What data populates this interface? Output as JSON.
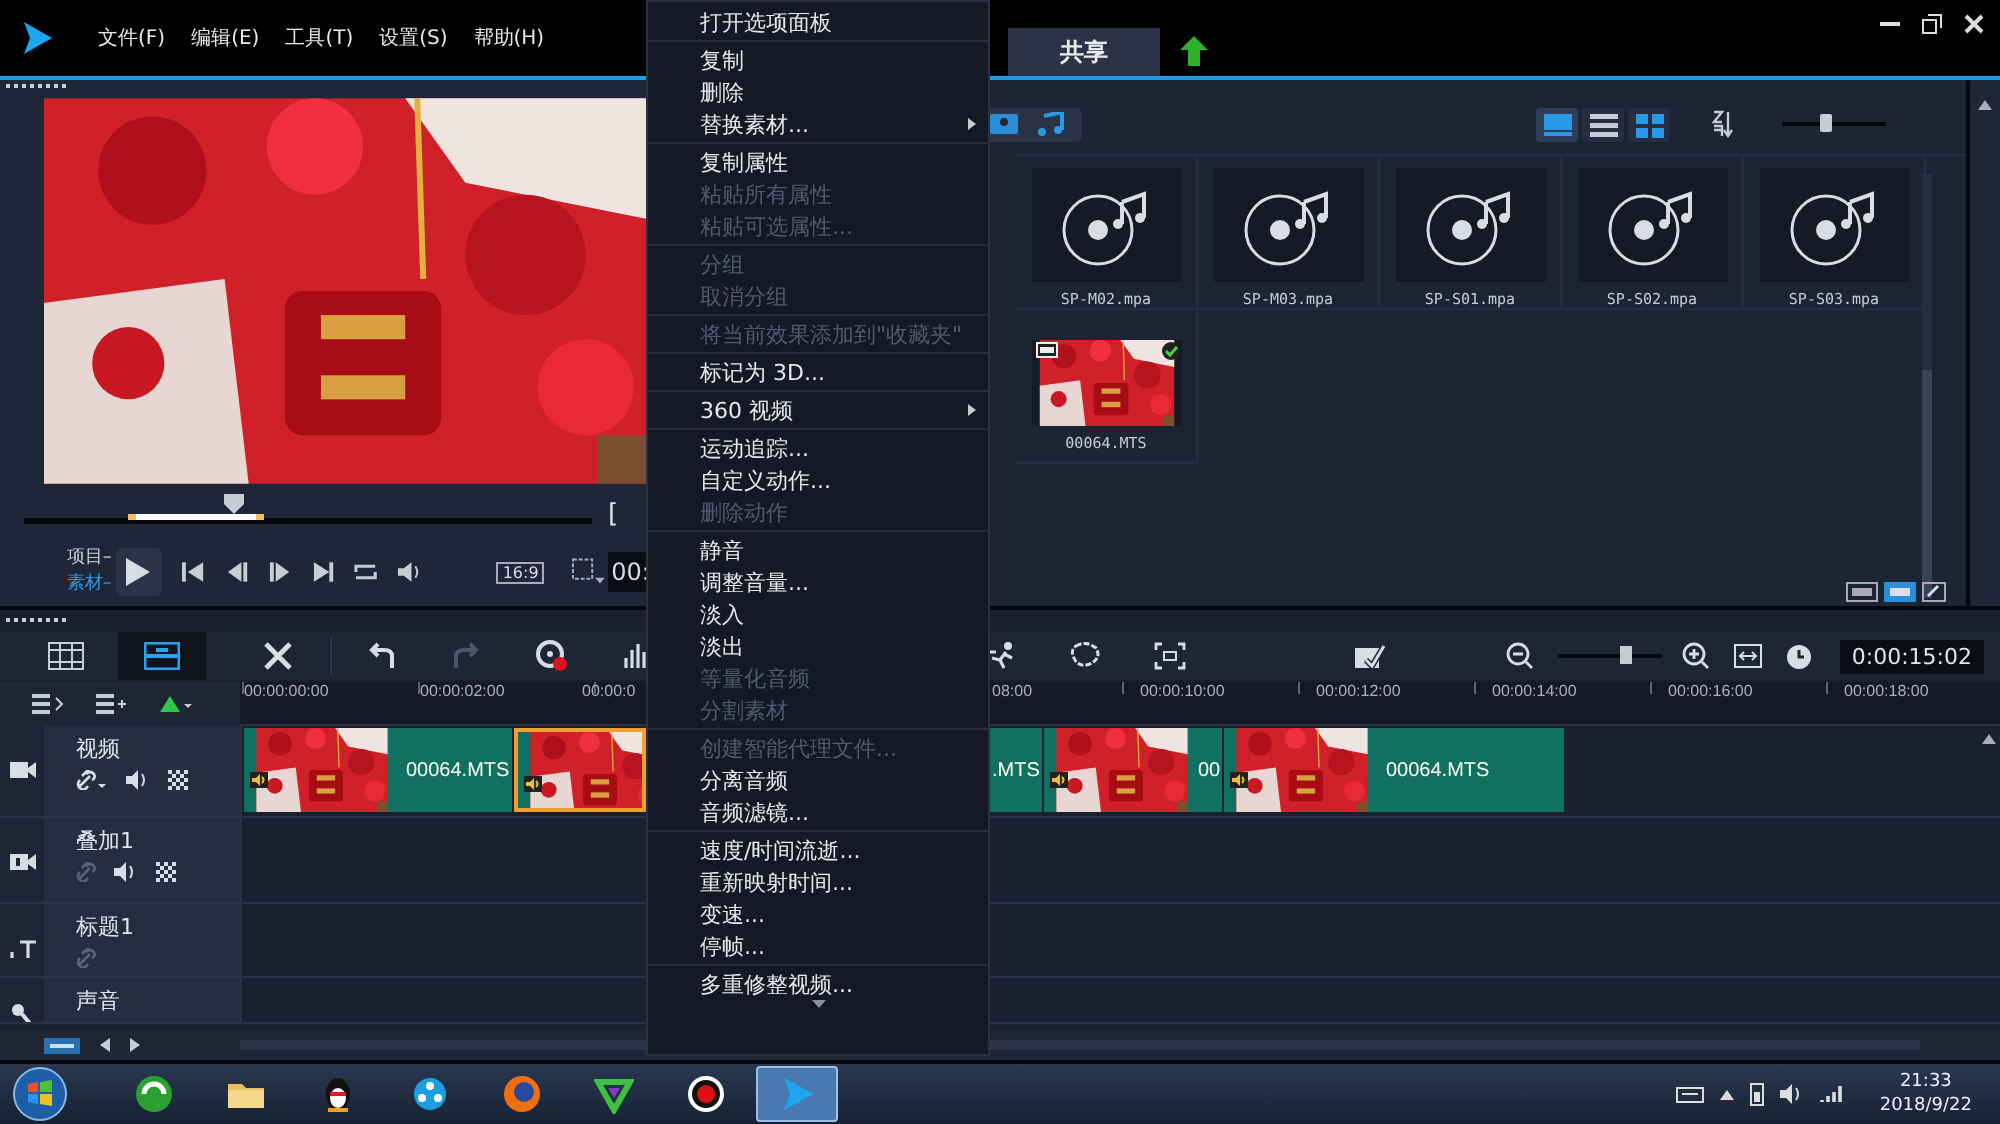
{
  "app_menu": [
    "文件(F)",
    "编辑(E)",
    "工具(T)",
    "设置(S)",
    "帮助(H)"
  ],
  "workspace_tabs": [
    {
      "label": "共享",
      "selected": false
    }
  ],
  "preview": {
    "scrub": {
      "level": 0.37
    },
    "mark_in": "[",
    "modes": [
      {
        "label": "项目–",
        "selected": false
      },
      {
        "label": "素材–",
        "selected": true
      }
    ],
    "aspect": "16:9",
    "timecode": "00:"
  },
  "library": {
    "view_buttons": [
      {
        "selected": true
      },
      {
        "selected": false
      },
      {
        "selected": false
      }
    ],
    "zoom": {
      "level": 0.43
    },
    "items": [
      {
        "kind": "audio",
        "name": "SP-M02.mpa",
        "checked": false
      },
      {
        "kind": "audio",
        "name": "SP-M03.mpa",
        "checked": false
      },
      {
        "kind": "audio",
        "name": "SP-S01.mpa",
        "checked": false
      },
      {
        "kind": "audio",
        "name": "SP-S02.mpa",
        "checked": false
      },
      {
        "kind": "audio",
        "name": "SP-S03.mpa",
        "checked": false
      },
      {
        "kind": "video",
        "name": "00064.MTS",
        "checked": true
      }
    ]
  },
  "timeline": {
    "views": [
      {
        "selected": false
      },
      {
        "selected": true
      }
    ],
    "undo": {
      "disabled": false
    },
    "redo": {
      "disabled": true
    },
    "zoom": {
      "level": 0.66
    },
    "timecode": "0:00:15:02",
    "ruler": [
      "00:00:00:00",
      "00:00:02:00",
      "00:00:0",
      "08:00",
      "00:00:10:00",
      "00:00:12:00",
      "00:00:14:00",
      "00:00:16:00",
      "00:00:18:00"
    ],
    "tracks": [
      {
        "kind": "video",
        "name": "视频",
        "clips": [
          {
            "label": "00064.MTS",
            "selected": false
          },
          {
            "selected": true
          },
          {
            "label": ".MTS",
            "selected": false
          },
          {
            "label": "00",
            "selected": false
          },
          {
            "label": "00064.MTS",
            "selected": false
          }
        ]
      },
      {
        "kind": "overlay",
        "name": "叠加1"
      },
      {
        "kind": "title",
        "name": "标题1"
      },
      {
        "kind": "voice",
        "name": "声音"
      }
    ]
  },
  "context_menu": [
    {
      "kind": "item",
      "label": "打开选项面板",
      "disabled": false,
      "submenu": false
    },
    {
      "kind": "separator"
    },
    {
      "kind": "item",
      "label": "复制",
      "disabled": false,
      "submenu": false
    },
    {
      "kind": "item",
      "label": "删除",
      "disabled": false,
      "submenu": false
    },
    {
      "kind": "item",
      "label": "替换素材...",
      "disabled": false,
      "submenu": true
    },
    {
      "kind": "separator"
    },
    {
      "kind": "item",
      "label": "复制属性",
      "disabled": false,
      "submenu": false
    },
    {
      "kind": "item",
      "label": "粘贴所有属性",
      "disabled": true,
      "submenu": false
    },
    {
      "kind": "item",
      "label": "粘贴可选属性...",
      "disabled": true,
      "submenu": false
    },
    {
      "kind": "separator"
    },
    {
      "kind": "item",
      "label": "分组",
      "disabled": true,
      "submenu": false
    },
    {
      "kind": "item",
      "label": "取消分组",
      "disabled": true,
      "submenu": false
    },
    {
      "kind": "separator"
    },
    {
      "kind": "item",
      "label": "将当前效果添加到\"收藏夹\"",
      "disabled": true,
      "submenu": false
    },
    {
      "kind": "separator"
    },
    {
      "kind": "item",
      "label": "标记为 3D...",
      "disabled": false,
      "submenu": false
    },
    {
      "kind": "separator"
    },
    {
      "kind": "item",
      "label": "360 视频",
      "disabled": false,
      "submenu": true
    },
    {
      "kind": "separator"
    },
    {
      "kind": "item",
      "label": "运动追踪...",
      "disabled": false,
      "submenu": false
    },
    {
      "kind": "item",
      "label": "自定义动作...",
      "disabled": false,
      "submenu": false
    },
    {
      "kind": "item",
      "label": "删除动作",
      "disabled": true,
      "submenu": false
    },
    {
      "kind": "separator"
    },
    {
      "kind": "item",
      "label": "静音",
      "disabled": false,
      "submenu": false
    },
    {
      "kind": "item",
      "label": "调整音量...",
      "disabled": false,
      "submenu": false
    },
    {
      "kind": "item",
      "label": "淡入",
      "disabled": false,
      "submenu": false
    },
    {
      "kind": "item",
      "label": "淡出",
      "disabled": false,
      "submenu": false
    },
    {
      "kind": "item",
      "label": "等量化音频",
      "disabled": true,
      "submenu": false
    },
    {
      "kind": "item",
      "label": "分割素材",
      "disabled": true,
      "submenu": false
    },
    {
      "kind": "separator"
    },
    {
      "kind": "item",
      "label": "创建智能代理文件...",
      "disabled": true,
      "submenu": false
    },
    {
      "kind": "item",
      "label": "分离音频",
      "disabled": false,
      "submenu": false
    },
    {
      "kind": "item",
      "label": "音频滤镜...",
      "disabled": false,
      "submenu": false
    },
    {
      "kind": "separator"
    },
    {
      "kind": "item",
      "label": "速度/时间流逝...",
      "disabled": false,
      "submenu": false
    },
    {
      "kind": "item",
      "label": "重新映射时间...",
      "disabled": false,
      "submenu": false
    },
    {
      "kind": "item",
      "label": "变速...",
      "disabled": false,
      "submenu": false
    },
    {
      "kind": "item",
      "label": "停帧...",
      "disabled": false,
      "submenu": false
    },
    {
      "kind": "separator"
    },
    {
      "kind": "item",
      "label": "多重修整视频...",
      "disabled": false,
      "submenu": false
    }
  ],
  "taskbar": {
    "apps": [
      {
        "selected": false
      },
      {
        "selected": false
      },
      {
        "selected": false
      },
      {
        "selected": false
      },
      {
        "selected": false
      },
      {
        "selected": false
      },
      {
        "selected": false
      },
      {
        "selected": true
      }
    ],
    "time": "21:33",
    "date": "2018/9/22"
  }
}
